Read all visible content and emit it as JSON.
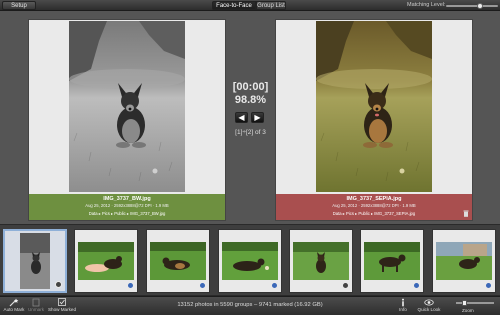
{
  "toolbar": {
    "setup_label": "Setup",
    "tabs": [
      {
        "label": "Face-to-Face",
        "active": true
      },
      {
        "label": "Group List",
        "active": false
      }
    ],
    "matching_label": "Matching Level:",
    "matching_level": 0.65
  },
  "compare": {
    "left": {
      "name": "IMG_3737_BW.jpg",
      "meta": "Aug 25, 2012 · 2592x3888@72 DPI · 1.9 MB",
      "path": "Data ▸ Pics ▸ Public ▸ IMG_3737_BW.jpg",
      "color": "#6e9040"
    },
    "right": {
      "name": "IMG_3737_SEPIA.jpg",
      "meta": "Aug 25, 2012 · 2592x3888@72 DPI · 1.9 MB",
      "path": "Data ▸ Pics ▸ Public ▸ IMG_3737_SEPIA.jpg",
      "color": "#a94f4f"
    },
    "timer": "[00:00]",
    "similarity": "98.8%",
    "pair_count": "[1]÷[2] of 3",
    "prev_icon": "arrow-left-icon",
    "next_icon": "arrow-right-icon"
  },
  "filmstrip": {
    "thumbnails": [
      {
        "subject": "dog sitting on grass, black and white",
        "selected": true
      },
      {
        "subject": "child lying with dog on grass"
      },
      {
        "subject": "dog lying on grass"
      },
      {
        "subject": "dog lying on grass with toy"
      },
      {
        "subject": "dog sitting in field"
      },
      {
        "subject": "dog standing on grass"
      },
      {
        "subject": "dog standing near house"
      }
    ]
  },
  "bottombar": {
    "auto_mark": "Auto Mark",
    "unmark": "Unmark",
    "show_marked": "Show Marked",
    "status": "13152 photos in 5590 groups – 9741 marked (16.92 GB)",
    "info": "Info",
    "quick_look": "Quick Look",
    "zoom": "Zoom"
  },
  "colors": {
    "accent_green": "#6e9040",
    "accent_red": "#a94f4f",
    "badge_blue": "#3b68b8"
  }
}
